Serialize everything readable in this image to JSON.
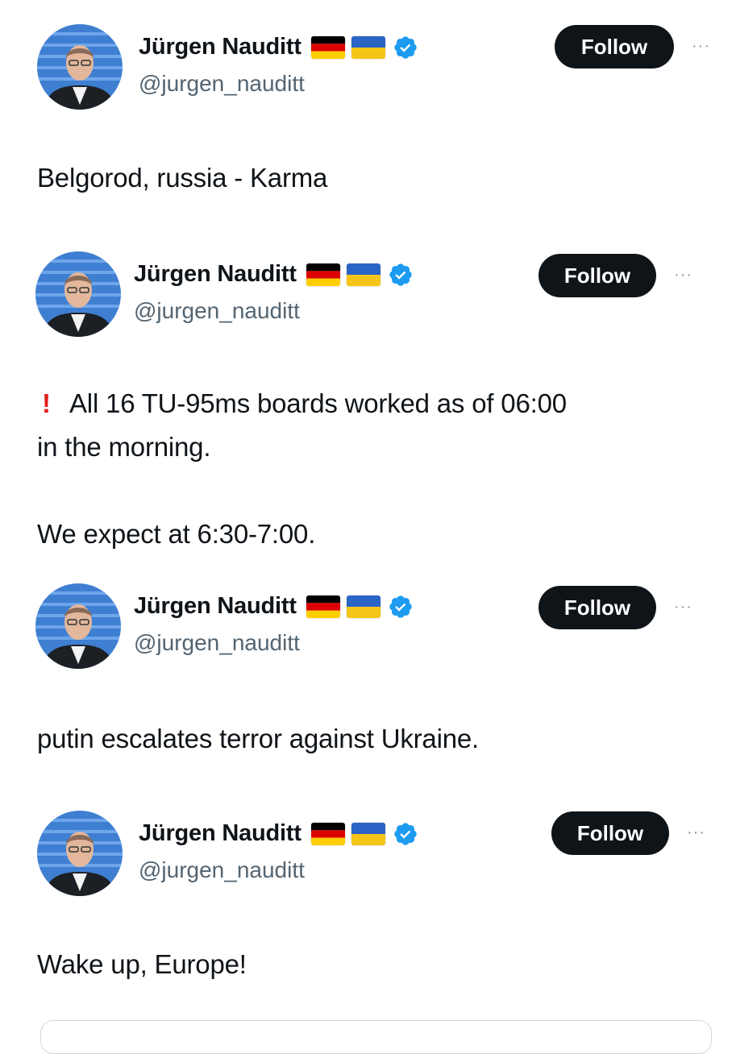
{
  "tweets": [
    {
      "author": {
        "name": "Jürgen Nauditt",
        "handle": "@jurgen_nauditt",
        "verified": true,
        "flags": [
          "germany-flag",
          "ukraine-flag"
        ]
      },
      "follow_label": "Follow",
      "more_label": "···",
      "text_lines": [
        "Belgorod, russia - Karma"
      ]
    },
    {
      "author": {
        "name": "Jürgen Nauditt",
        "handle": "@jurgen_nauditt",
        "verified": true,
        "flags": [
          "germany-flag",
          "ukraine-flag"
        ]
      },
      "follow_label": "Follow",
      "more_label": "···",
      "text_prefix_icon": "exclamation-emoji",
      "text_prefix": "!",
      "text_lines": [
        "All 16 TU-95ms boards worked as of 06:00",
        "in the morning.",
        "",
        "We expect at 6:30-7:00."
      ]
    },
    {
      "author": {
        "name": "Jürgen Nauditt",
        "handle": "@jurgen_nauditt",
        "verified": true,
        "flags": [
          "germany-flag",
          "ukraine-flag"
        ]
      },
      "follow_label": "Follow",
      "more_label": "···",
      "text_lines": [
        "putin escalates terror against Ukraine."
      ]
    },
    {
      "author": {
        "name": "Jürgen Nauditt",
        "handle": "@jurgen_nauditt",
        "verified": true,
        "flags": [
          "germany-flag",
          "ukraine-flag"
        ]
      },
      "follow_label": "Follow",
      "more_label": "···",
      "text_lines": [
        "Wake up, Europe!"
      ]
    }
  ],
  "colors": {
    "text": "#0f1419",
    "secondary": "#536471",
    "follow_bg": "#0f1419",
    "follow_text": "#ffffff",
    "verified_blue": "#1d9bf0",
    "alert_red": "#e0201b"
  }
}
